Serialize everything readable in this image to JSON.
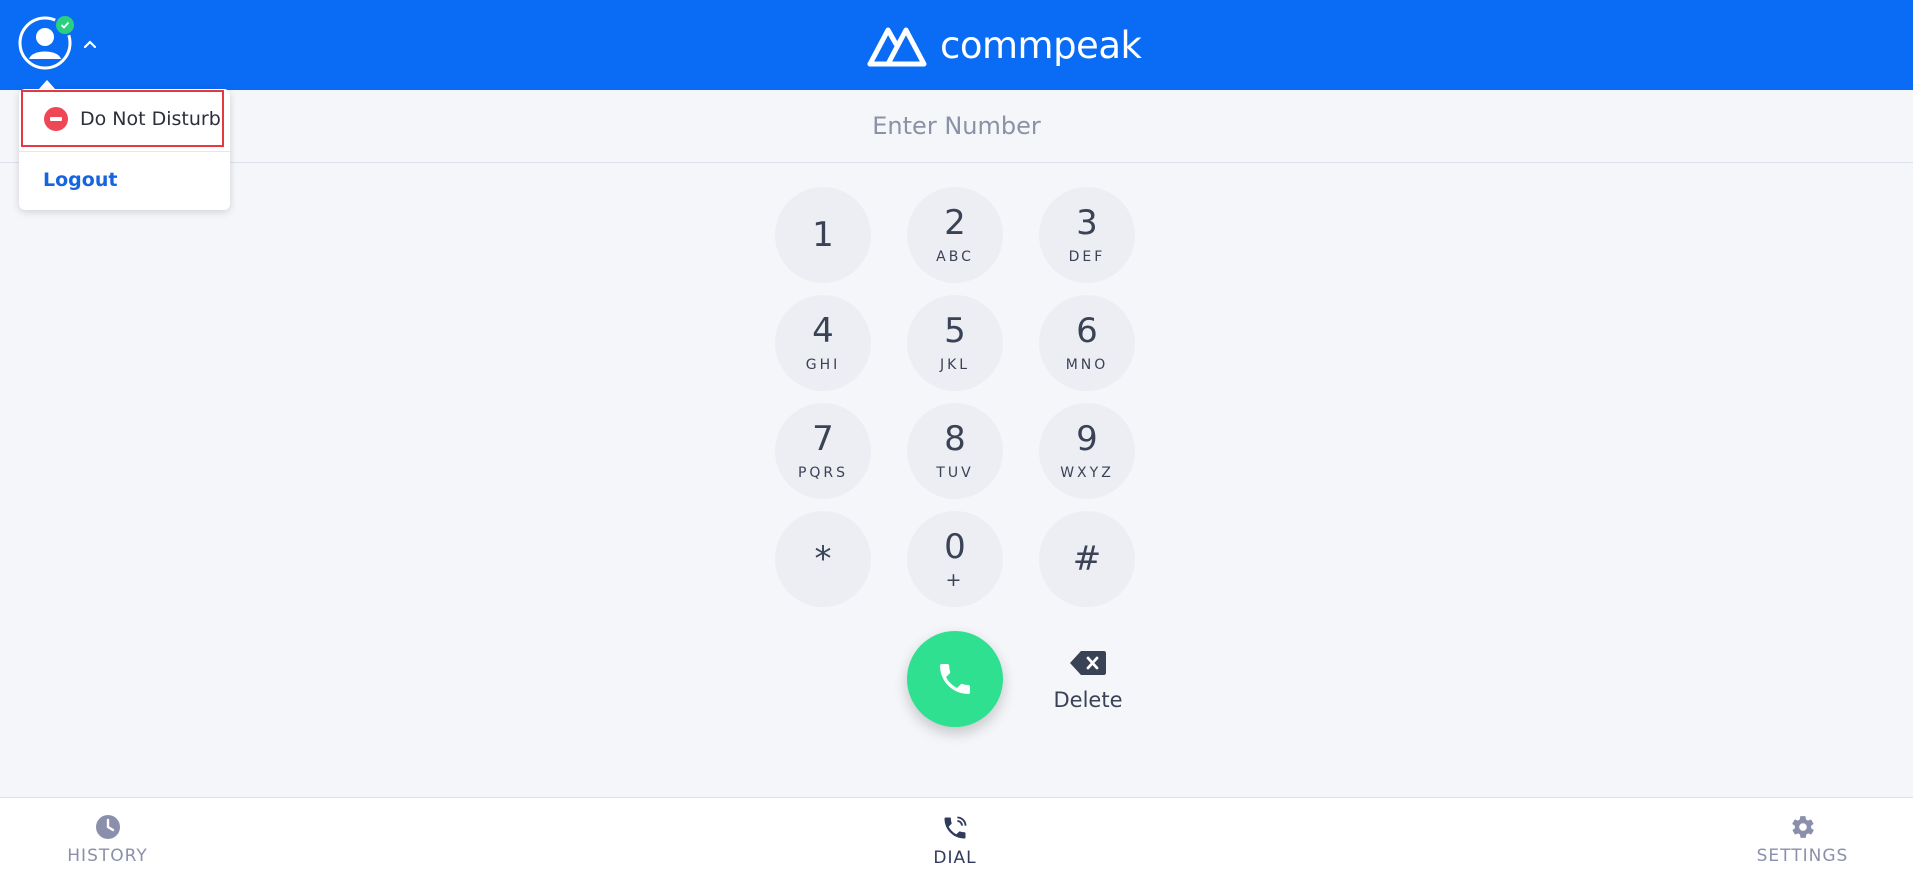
{
  "header": {
    "logo_text": "commpeak",
    "status": "online"
  },
  "status_menu": {
    "dnd_label": "Do Not Disturb",
    "logout_label": "Logout"
  },
  "number_input": {
    "placeholder": "Enter Number",
    "value": ""
  },
  "dialpad": {
    "keys": [
      {
        "digit": "1",
        "letters": ""
      },
      {
        "digit": "2",
        "letters": "ABC"
      },
      {
        "digit": "3",
        "letters": "DEF"
      },
      {
        "digit": "4",
        "letters": "GHI"
      },
      {
        "digit": "5",
        "letters": "JKL"
      },
      {
        "digit": "6",
        "letters": "MNO"
      },
      {
        "digit": "7",
        "letters": "PQRS"
      },
      {
        "digit": "8",
        "letters": "TUV"
      },
      {
        "digit": "9",
        "letters": "WXYZ"
      },
      {
        "digit": "*",
        "letters": ""
      },
      {
        "digit": "0",
        "letters": "+"
      },
      {
        "digit": "#",
        "letters": ""
      }
    ]
  },
  "actions": {
    "delete_label": "Delete"
  },
  "bottom_nav": {
    "history": "HISTORY",
    "dial": "DIAL",
    "settings": "SETTINGS"
  },
  "colors": {
    "header_bg": "#0a6cf5",
    "call_green": "#2ee08f",
    "dnd_red": "#f04757",
    "online_green": "#2bcf7f",
    "active_nav": "#2f3a5c",
    "inactive_nav": "#8a90ab"
  }
}
